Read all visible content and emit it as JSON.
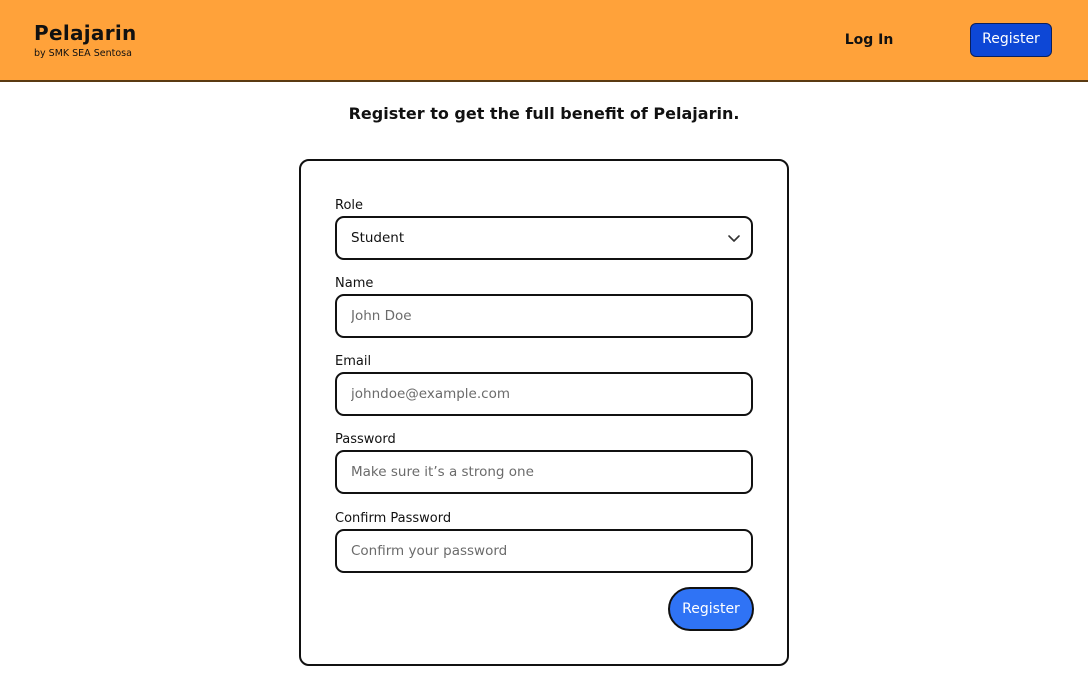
{
  "brand": {
    "name": "Pelajarin",
    "subtitle": "by SMK SEA Sentosa"
  },
  "nav": {
    "login_label": "Log In",
    "register_label": "Register"
  },
  "page": {
    "headline": "Register to get the full benefit of Pelajarin."
  },
  "form": {
    "role": {
      "label": "Role",
      "value": "Student",
      "icon": "chevron-down-icon"
    },
    "name": {
      "label": "Name",
      "placeholder": "John Doe"
    },
    "email": {
      "label": "Email",
      "placeholder": "johndoe@example.com"
    },
    "password": {
      "label": "Password",
      "placeholder": "Make sure it’s a strong one"
    },
    "confirm_password": {
      "label": "Confirm Password",
      "placeholder": "Confirm your password"
    },
    "submit_label": "Register"
  },
  "colors": {
    "header_bg": "#ffa23a",
    "nav_register_bg": "#0d47d6",
    "submit_bg": "#2f73f5"
  }
}
